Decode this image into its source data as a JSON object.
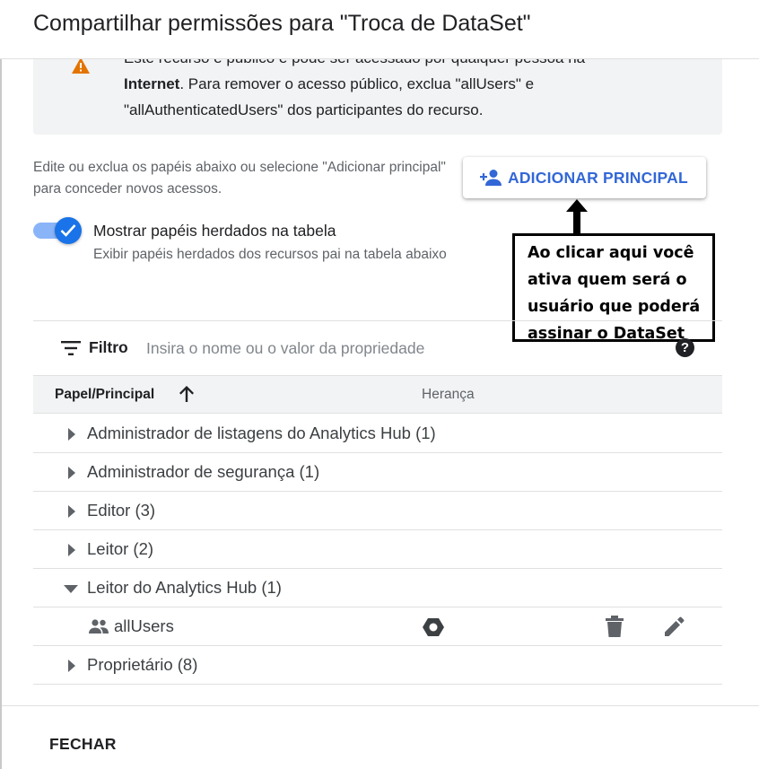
{
  "dialog": {
    "title": "Compartilhar permissões para \"Troca de DataSet\""
  },
  "warning": {
    "line1": "Este recurso é público e pode ser acessado por qualquer pessoa na",
    "bold_word": "Internet",
    "line2_rest": ". Para remover o acesso público, exclua \"allUsers\" e",
    "line3": "\"allAuthenticatedUsers\" dos participantes do recurso."
  },
  "instructions": "Edite ou exclua os papéis abaixo ou selecione \"Adicionar principal\" para conceder novos acessos.",
  "add_principal": {
    "label": "ADICIONAR PRINCIPAL",
    "icon": "person-add-icon",
    "color": "#3367d6"
  },
  "toggle": {
    "state": "on",
    "label": "Mostrar papéis herdados na tabela",
    "sublabel": "Exibir papéis herdados dos recursos pai na tabela abaixo",
    "color": "#1a73e8"
  },
  "annotation": {
    "lines": [
      "Ao clicar aqui você",
      "ativa quem será o",
      "usuário que poderá",
      "assinar o DataSet"
    ]
  },
  "filter": {
    "label": "Filtro",
    "placeholder": "Insira o nome ou o valor da propriedade",
    "value": ""
  },
  "table": {
    "columns": {
      "role": "Papel/Principal",
      "inheritance": "Herança"
    },
    "sort": "ascending",
    "rows": [
      {
        "label": "Administrador de listagens do Analytics Hub (1)",
        "expanded": false
      },
      {
        "label": "Administrador de segurança (1)",
        "expanded": false
      },
      {
        "label": "Editor (3)",
        "expanded": false
      },
      {
        "label": "Leitor (2)",
        "expanded": false
      },
      {
        "label": "Leitor do Analytics Hub (1)",
        "expanded": true
      },
      {
        "label": "Proprietário (8)",
        "expanded": false
      }
    ],
    "member": {
      "label": "allUsers",
      "icon": "group-icon",
      "inheritance_icon": "hexagon-project-icon"
    }
  },
  "footer": {
    "close_label": "FECHAR"
  },
  "colors": {
    "warning": "#e37400",
    "accent": "#1a73e8",
    "header_bg": "#f1f3f4"
  }
}
